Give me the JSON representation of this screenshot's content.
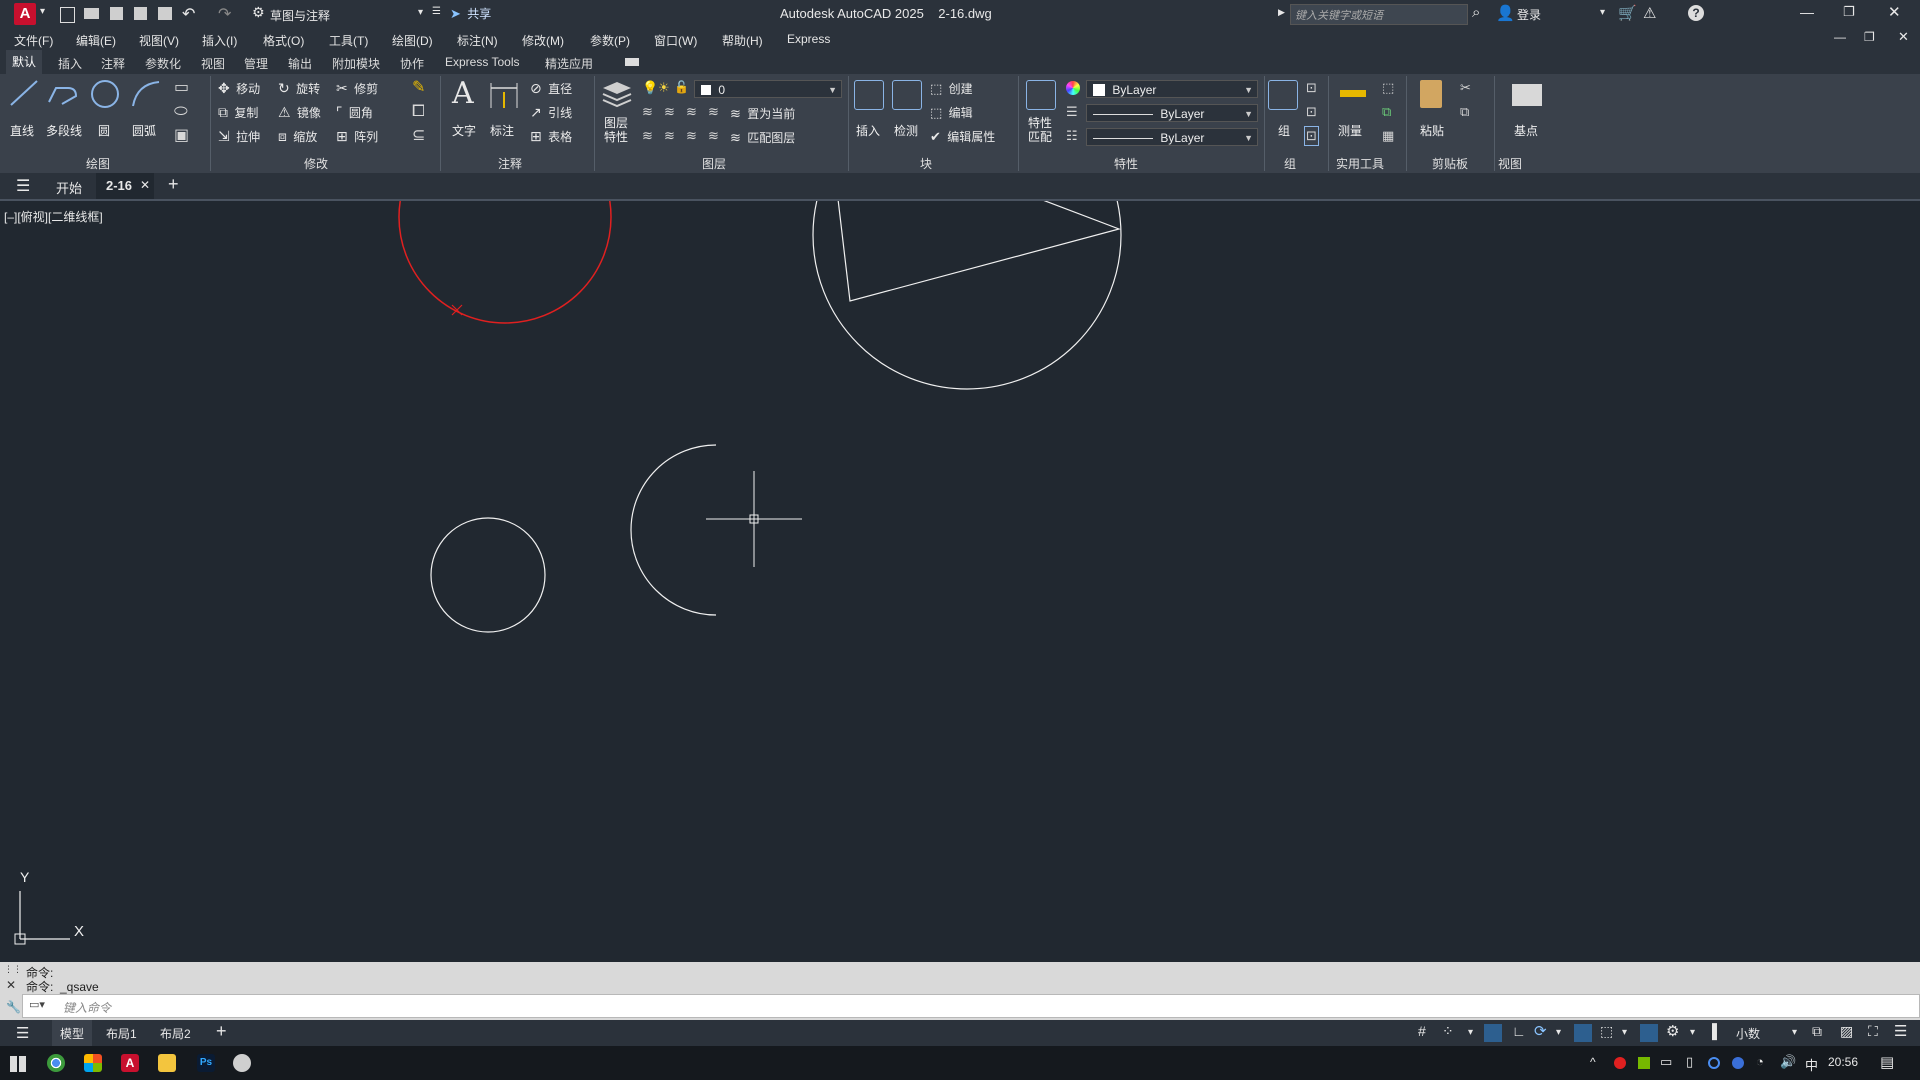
{
  "title_bar": {
    "app_logo": "A",
    "workspace": "草图与注释",
    "share": "共享",
    "title": "Autodesk AutoCAD 2025    2-16.dwg",
    "search_placeholder": "键入关键字或短语",
    "login": "登录"
  },
  "menu": [
    "文件(F)",
    "编辑(E)",
    "视图(V)",
    "插入(I)",
    "格式(O)",
    "工具(T)",
    "绘图(D)",
    "标注(N)",
    "修改(M)",
    "参数(P)",
    "窗口(W)",
    "帮助(H)",
    "Express"
  ],
  "ribbon_tabs": [
    "默认",
    "插入",
    "注释",
    "参数化",
    "视图",
    "管理",
    "输出",
    "附加模块",
    "协作",
    "Express Tools",
    "精选应用"
  ],
  "ribbon": {
    "draw": {
      "line": "直线",
      "polyline": "多段线",
      "circle": "圆",
      "arc": "圆弧",
      "title": "绘图"
    },
    "modify": {
      "move": "移动",
      "rotate": "旋转",
      "trim": "修剪",
      "copy": "复制",
      "mirror": "镜像",
      "fillet": "圆角",
      "stretch": "拉伸",
      "scale": "缩放",
      "array": "阵列",
      "title": "修改"
    },
    "annotation": {
      "text": "文字",
      "dimension": "标注",
      "diameter": "直径",
      "leader": "引线",
      "table": "表格",
      "title": "注释"
    },
    "layers": {
      "props": "图层\n特性",
      "layer_value": "0",
      "set_current": "置为当前",
      "match_layer": "匹配图层",
      "title": "图层"
    },
    "block": {
      "insert": "插入",
      "inspect": "检测",
      "create": "创建",
      "edit": "编辑",
      "edit_attr": "编辑属性",
      "title": "块"
    },
    "properties": {
      "match": "特性\n匹配",
      "color": "ByLayer",
      "linetype": "ByLayer",
      "lineweight": "ByLayer",
      "title": "特性"
    },
    "group": {
      "label": "组",
      "title": "组"
    },
    "utilities": {
      "measure": "测量",
      "title": "实用工具"
    },
    "clipboard": {
      "paste": "粘贴",
      "title": "剪贴板"
    },
    "view": {
      "base": "基点",
      "title": "视图"
    }
  },
  "file_tabs": {
    "start": "开始",
    "current": "2-16"
  },
  "viewport_label": "[–][俯视][二维线框]",
  "ucs": {
    "y": "Y",
    "x": "X"
  },
  "command": {
    "line1": "命令:",
    "line2": "命令:  _qsave",
    "placeholder": "键入命令"
  },
  "layout_tabs": [
    "模型",
    "布局1",
    "布局2"
  ],
  "status": {
    "units": "小数"
  },
  "taskbar": {
    "time": "20:56",
    "ime": "中"
  }
}
